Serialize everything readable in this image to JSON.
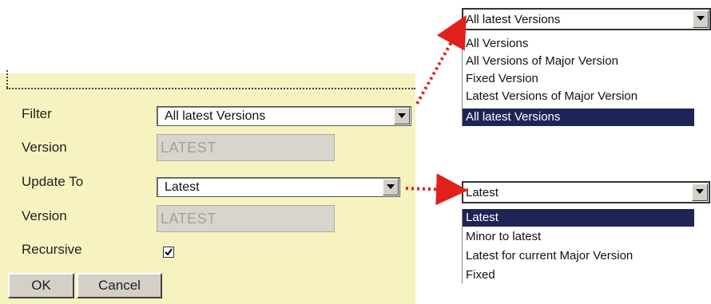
{
  "form": {
    "filter_label": "Filter",
    "filter_value": "All latest Versions",
    "version_label_1": "Version",
    "version_value_1": "LATEST",
    "update_to_label": "Update To",
    "update_to_value": "Latest",
    "version_label_2": "Version",
    "version_value_2": "LATEST",
    "recursive_label": "Recursive",
    "recursive_checked": true,
    "ok_label": "OK",
    "cancel_label": "Cancel"
  },
  "filter_dropdown": {
    "selected": "All latest Versions",
    "options": [
      "All Versions",
      "All Versions of Major Version",
      "Fixed Version",
      "Latest Versions of Major Version",
      "All latest Versions"
    ],
    "highlighted_index": 4
  },
  "update_dropdown": {
    "selected": "Latest",
    "options": [
      "Latest",
      "Minor to latest",
      "Latest for current Major Version",
      "Fixed"
    ],
    "highlighted_index": 0
  },
  "colors": {
    "panel": "#f6f3c0",
    "connector": "#e0201a",
    "highlight": "#1f2457"
  }
}
